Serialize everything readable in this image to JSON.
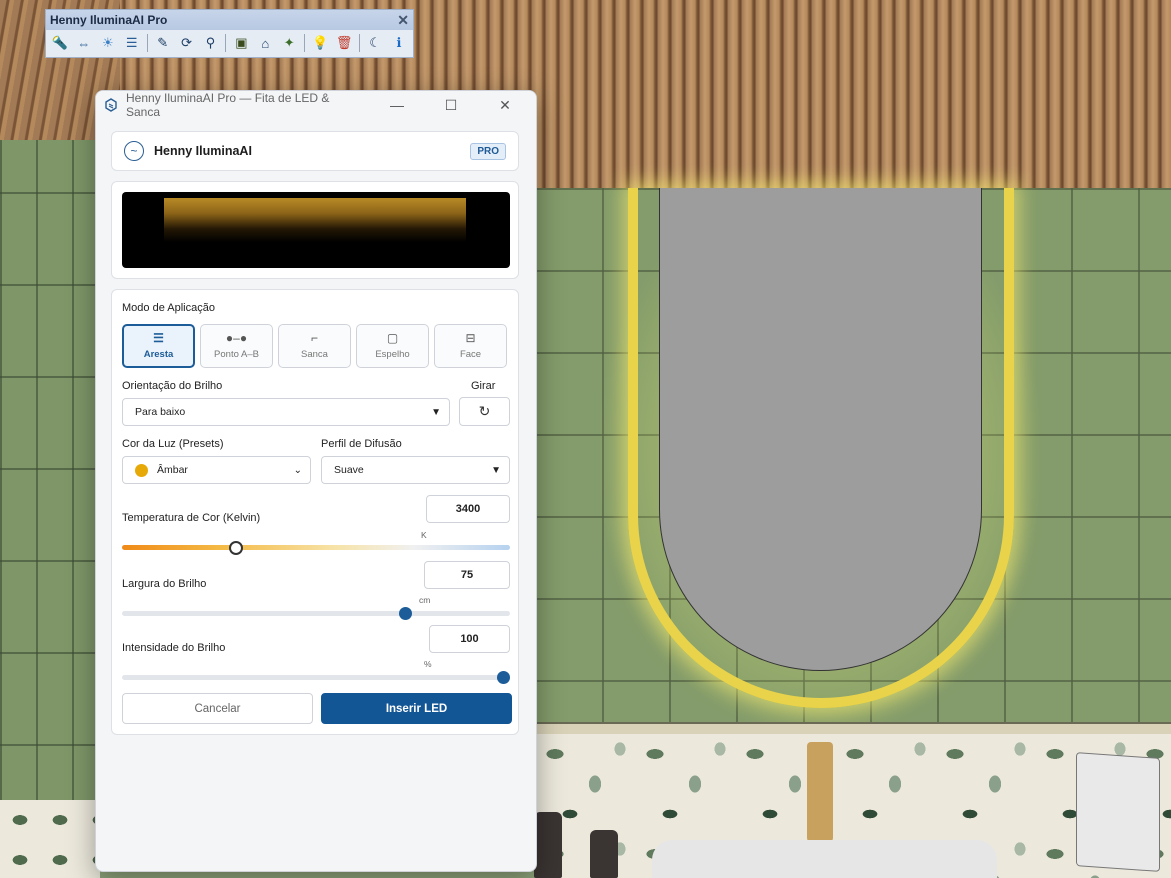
{
  "toolbar": {
    "title": "Henny IluminaAI Pro",
    "close_glyph": "✕",
    "icons": [
      {
        "name": "spotlight-icon",
        "glyph": "🔦"
      },
      {
        "name": "led-strip-icon",
        "glyph": "⇔"
      },
      {
        "name": "light-bulb-ring-icon",
        "glyph": "☀"
      },
      {
        "name": "sliders-icon",
        "glyph": "☰"
      },
      {
        "name": "edit-light-icon",
        "glyph": "✎"
      },
      {
        "name": "refresh-render-icon",
        "glyph": "⟳"
      },
      {
        "name": "search-lights-icon",
        "glyph": "⚲"
      },
      {
        "name": "select-frame-icon",
        "glyph": "▣"
      },
      {
        "name": "cove-icon",
        "glyph": "⌂"
      },
      {
        "name": "sparkle-icon",
        "glyph": "✦"
      },
      {
        "name": "bulb-icon",
        "glyph": "💡"
      },
      {
        "name": "delete-icon",
        "glyph": "🗑"
      },
      {
        "name": "night-mode-icon",
        "glyph": "☾"
      },
      {
        "name": "info-icon",
        "glyph": "ℹ"
      }
    ]
  },
  "window": {
    "title": "Henny IluminaAI Pro — Fita de LED & Sanca",
    "minimize_glyph": "—",
    "maximize_glyph": "☐",
    "close_glyph": "✕"
  },
  "brand": {
    "name": "Henny IluminaAI",
    "badge": "PRO",
    "logo_glyph": "~"
  },
  "mode": {
    "label": "Modo de Aplicação",
    "options": [
      {
        "label": "Aresta",
        "icon": "☰",
        "active": true
      },
      {
        "label": "Ponto A–B",
        "icon": "●–●",
        "active": false
      },
      {
        "label": "Sanca",
        "icon": "⌐",
        "active": false
      },
      {
        "label": "Espelho",
        "icon": "▢",
        "active": false
      },
      {
        "label": "Face",
        "icon": "⊟",
        "active": false
      }
    ]
  },
  "orientation": {
    "label": "Orientação do Brilho",
    "value": "Para baixo",
    "rotate_label": "Girar",
    "rotate_glyph": "↻"
  },
  "color": {
    "label": "Cor da Luz (Presets)",
    "value": "Âmbar",
    "swatch": "#e7a908"
  },
  "diffusion": {
    "label": "Perfil de Difusão",
    "value": "Suave"
  },
  "temperature": {
    "label": "Temperatura de Cor (Kelvin)",
    "value": "3400",
    "unit": "K",
    "fraction": 0.29
  },
  "width": {
    "label": "Largura do Brilho",
    "value": "75",
    "unit": "cm",
    "fraction": 0.73
  },
  "intensity": {
    "label": "Intensidade do Brilho",
    "value": "100",
    "unit": "%",
    "fraction": 1.0
  },
  "actions": {
    "cancel": "Cancelar",
    "insert": "Inserir LED"
  },
  "colors": {
    "accent": "#135696",
    "amber": "#e7a908"
  }
}
